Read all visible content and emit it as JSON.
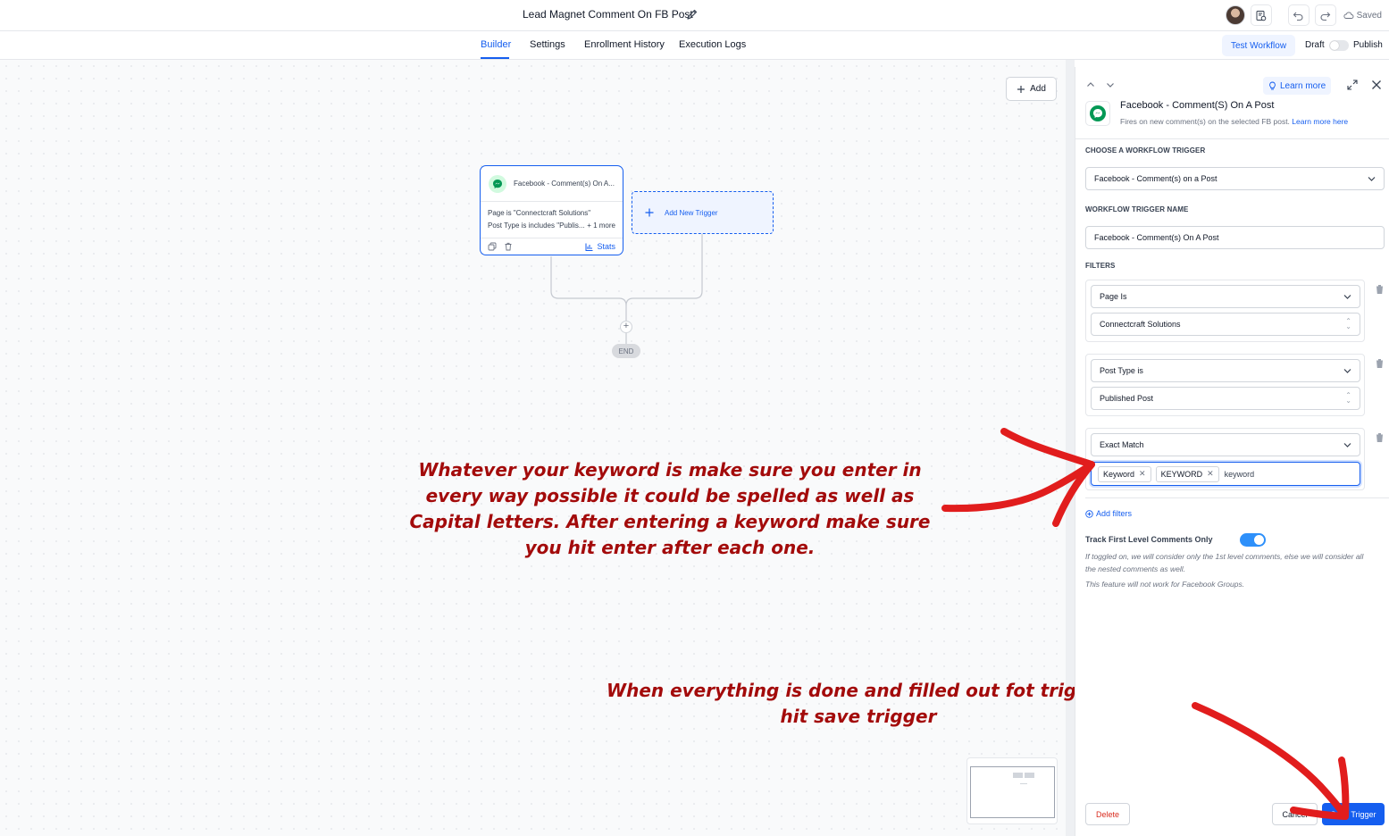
{
  "header": {
    "workflow_title": "Lead Magnet Comment On FB Post",
    "saved_label": "Saved"
  },
  "tabs": [
    {
      "label": "Builder",
      "active": true
    },
    {
      "label": "Settings"
    },
    {
      "label": "Enrollment History"
    },
    {
      "label": "Execution Logs"
    }
  ],
  "toolbar": {
    "test_workflow_label": "Test Workflow",
    "draft_label": "Draft",
    "publish_label": "Publish",
    "publish_toggle_on": false
  },
  "canvas": {
    "add_label": "Add",
    "trigger_card": {
      "title": "Facebook - Comment(s) On A...",
      "line1": "Page is \"Connectcraft Solutions\"",
      "line2": "Post Type is includes \"Publis...",
      "more": "+ 1 more",
      "stats_label": "Stats"
    },
    "add_new_trigger_label": "Add New Trigger",
    "end_label": "END"
  },
  "annotations": {
    "keyword_note": "Whatever your keyword is make sure you enter in every way possible it could be spelled as well as Capital letters. After entering a keyword make sure you hit enter after each one.",
    "save_note": "When everything is done and filled out fot trigger hit save trigger"
  },
  "panel": {
    "learn_more_label": "Learn more",
    "title": "Facebook - Comment(S) On A Post",
    "description": "Fires on new comment(s) on the selected FB post.",
    "description_link": "Learn more here",
    "choose_trigger_label": "CHOOSE A WORKFLOW TRIGGER",
    "trigger_value": "Facebook - Comment(s) on a Post",
    "trigger_name_label": "WORKFLOW TRIGGER NAME",
    "trigger_name_value": "Facebook - Comment(s) On A Post",
    "filters_label": "FILTERS",
    "filters": [
      {
        "field": "Page Is",
        "value": "Connectcraft Solutions"
      },
      {
        "field": "Post Type is",
        "value": "Published Post"
      },
      {
        "field": "Exact Match",
        "tags": [
          "Keyword",
          "KEYWORD"
        ],
        "typed": "keyword"
      }
    ],
    "add_filters_label": "Add filters",
    "track_label": "Track First Level Comments Only",
    "track_toggle_on": true,
    "help_text_1": "If toggled on, we will consider only the 1st level comments, else we will consider all the nested comments as well.",
    "help_text_2": "This feature will not work for Facebook Groups.",
    "delete_label": "Delete",
    "cancel_label": "Cancel",
    "save_label": "Save Trigger"
  },
  "colors": {
    "accent": "#155eef",
    "annotation": "#a30b0b",
    "danger": "#d92d20"
  }
}
